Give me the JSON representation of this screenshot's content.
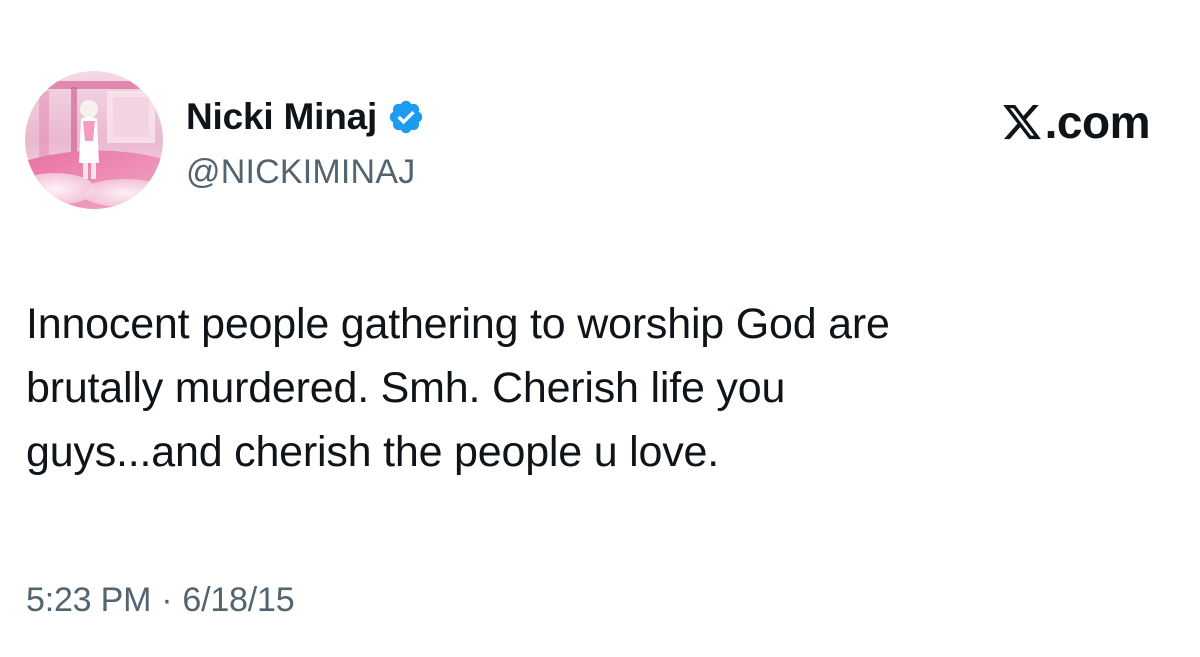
{
  "author": {
    "display_name": "Nicki Minaj",
    "handle": "@NICKIMINAJ",
    "verified": true,
    "verified_color": "#1d9bf0",
    "avatar_icon": "profile-photo"
  },
  "brand": {
    "icon": "x-logo-icon",
    "suffix": ".com"
  },
  "tweet": {
    "lines": [
      "Innocent people gathering to worship God are",
      "brutally murdered. Smh. Cherish life you",
      "guys...and cherish the people u love."
    ]
  },
  "meta": {
    "time": "5:23 PM",
    "separator": "·",
    "date": "6/18/15"
  },
  "colors": {
    "text_primary": "#0f1419",
    "text_secondary": "#536471",
    "background": "#ffffff"
  }
}
